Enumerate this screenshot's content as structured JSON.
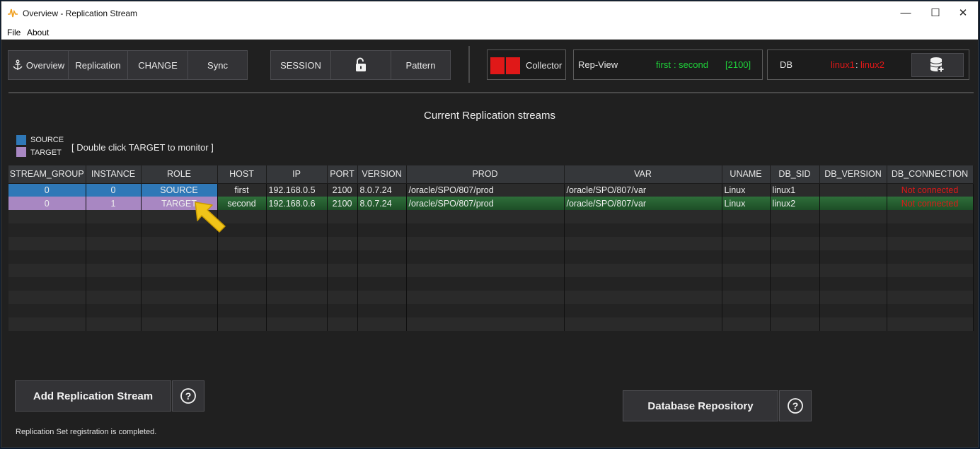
{
  "window": {
    "title": "Overview - Replication Stream",
    "controls": {
      "minimize": "—",
      "maximize": "☐",
      "close": "✕"
    }
  },
  "menu": [
    "File",
    "About"
  ],
  "toolbar": {
    "overview": "Overview",
    "replication": "Replication",
    "change": "CHANGE",
    "sync": "Sync",
    "session": "SESSION",
    "lock_icon": "unlock-icon",
    "pattern": "Pattern",
    "collector": "Collector",
    "collector_color": "#e01818"
  },
  "repview": {
    "label": "Rep-View",
    "first": "first",
    "sep": ":",
    "second": "second",
    "port": "[2100]",
    "color": "#1fd13a"
  },
  "db": {
    "label": "DB",
    "first": "linux1",
    "sep": ":",
    "second": "linux2",
    "color": "#e01818",
    "add_icon": "database-add-icon"
  },
  "main": {
    "title": "Current Replication streams",
    "legend": {
      "source": "SOURCE",
      "source_color": "#2f78b7",
      "target": "TARGET",
      "target_color": "#a887c2"
    },
    "hint": "[ Double click TARGET to monitor ]"
  },
  "table": {
    "columns": [
      "STREAM_GROUP",
      "INSTANCE",
      "ROLE",
      "HOST",
      "IP",
      "PORT",
      "VERSION",
      "PROD",
      "VAR",
      "UNAME",
      "DB_SID",
      "DB_VERSION",
      "DB_CONNECTION"
    ],
    "rows": [
      [
        "0",
        "0",
        "SOURCE",
        "first",
        "192.168.0.5",
        "2100",
        "8.0.7.24",
        "/oracle/SPO/807/prod",
        "/oracle/SPO/807/var",
        "Linux",
        "linux1",
        "",
        "Not connected"
      ],
      [
        "0",
        "1",
        "TARGET",
        "second",
        "192.168.0.6",
        "2100",
        "8.0.7.24",
        "/oracle/SPO/807/prod",
        "/oracle/SPO/807/var",
        "Linux",
        "linux2",
        "",
        "Not connected"
      ]
    ]
  },
  "buttons": {
    "add_stream": "Add Replication Stream",
    "db_repo": "Database Repository",
    "help": "?"
  },
  "status": "Replication Set registration is completed."
}
